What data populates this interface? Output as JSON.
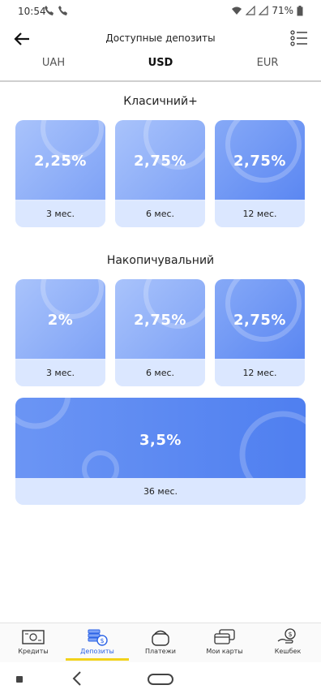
{
  "status": {
    "time": "10:54",
    "battery": "71%"
  },
  "header": {
    "title": "Доступные депозиты"
  },
  "tabs": [
    {
      "label": "UAH",
      "active": false
    },
    {
      "label": "USD",
      "active": true
    },
    {
      "label": "EUR",
      "active": false
    }
  ],
  "sections": [
    {
      "title": "Класичний+",
      "deposits": [
        {
          "rate": "2,25%",
          "term": "3 мес."
        },
        {
          "rate": "2,75%",
          "term": "6 мес."
        },
        {
          "rate": "2,75%",
          "term": "12 мес."
        }
      ]
    },
    {
      "title": "Накопичувальний",
      "deposits": [
        {
          "rate": "2%",
          "term": "3 мес."
        },
        {
          "rate": "2,75%",
          "term": "6 мес."
        },
        {
          "rate": "2,75%",
          "term": "12 мес."
        },
        {
          "rate": "3,5%",
          "term": "36 мес."
        }
      ]
    }
  ],
  "bottom_nav": [
    {
      "label": "Кредиты",
      "icon": "banknote-icon"
    },
    {
      "label": "Депозиты",
      "icon": "coin-stack-icon",
      "active": true
    },
    {
      "label": "Платежи",
      "icon": "wallet-icon"
    },
    {
      "label": "Мои карты",
      "icon": "cards-icon"
    },
    {
      "label": "Кешбек",
      "icon": "cashback-icon"
    }
  ],
  "colors": {
    "accent": "#2b63e6",
    "card_light": "#a9c3fb",
    "card_dark": "#5b87f2",
    "nav_underline": "#f2d21a"
  }
}
